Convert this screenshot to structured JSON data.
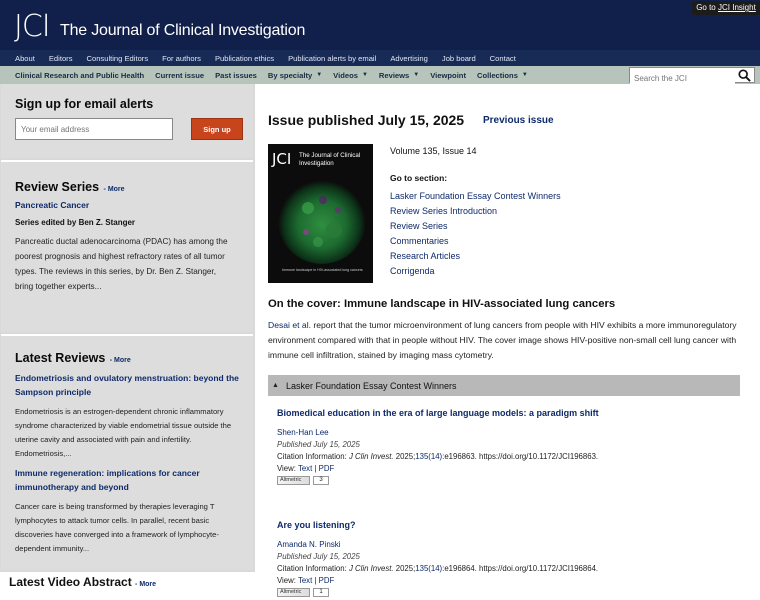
{
  "header": {
    "logo": "JCI",
    "journal_name": "The Journal of Clinical Investigation",
    "insight_prefix": "Go to",
    "insight_link": "JCI Insight"
  },
  "nav_primary": [
    "About",
    "Editors",
    "Consulting Editors",
    "For authors",
    "Publication ethics",
    "Publication alerts by email",
    "Advertising",
    "Job board",
    "Contact"
  ],
  "nav_secondary": [
    {
      "label": "Clinical Research and Public Health",
      "dropdown": false
    },
    {
      "label": "Current issue",
      "dropdown": false
    },
    {
      "label": "Past issues",
      "dropdown": false
    },
    {
      "label": "By specialty",
      "dropdown": true
    },
    {
      "label": "Videos",
      "dropdown": true
    },
    {
      "label": "Reviews",
      "dropdown": true
    },
    {
      "label": "Viewpoint",
      "dropdown": false
    },
    {
      "label": "Collections",
      "dropdown": true
    }
  ],
  "search": {
    "placeholder": "Search the JCI"
  },
  "sidebar": {
    "email": {
      "heading": "Sign up for email alerts",
      "placeholder": "Your email address",
      "button": "Sign up"
    },
    "review_series": {
      "heading": "Review Series",
      "more": "- More",
      "title": "Pancreatic Cancer",
      "editor": "Series edited by Ben Z. Stanger",
      "body": "Pancreatic ductal adenocarcinoma (PDAC) has among the poorest prognosis and highest refractory rates of all tumor types. The reviews in this series, by Dr. Ben Z. Stanger, bring together experts..."
    },
    "latest_reviews": {
      "heading": "Latest Reviews",
      "more": "- More",
      "items": [
        {
          "title": "Endometriosis and ovulatory menstruation: beyond the Sampson principle",
          "body": "Endometriosis is an estrogen-dependent chronic inflammatory syndrome characterized by viable endometrial tissue outside the uterine cavity and associated with pain and infertility. Endometriosis,..."
        },
        {
          "title": "Immune regeneration: implications for cancer immunotherapy and beyond",
          "body": "Cancer care is being transformed by therapies leveraging T lymphocytes to attack tumor cells. In parallel, recent basic discoveries have converged into a framework of lymphocyte-dependent immunity..."
        }
      ]
    },
    "latest_video": {
      "heading": "Latest Video Abstract",
      "more": "- More"
    }
  },
  "main": {
    "issue_title": "Issue published July 15, 2025",
    "previous_issue": "Previous issue",
    "cover_text": "The Journal of Clinical Investigation",
    "cover_caption": "Immune landscape in HIV-associated lung cancers",
    "volume": "Volume 135, Issue 14",
    "goto_label": "Go to section:",
    "sections": [
      "Lasker Foundation Essay Contest Winners",
      "Review Series Introduction",
      "Review Series",
      "Commentaries",
      "Research Articles",
      "Corrigenda"
    ],
    "cover_heading": "On the cover: Immune landscape in HIV-associated lung cancers",
    "cover_desc_link": "Desai et al.",
    "cover_desc": " report that the tumor microenvironment of lung cancers from people with HIV exhibits a more immunoregulatory environment compared with that in people without HIV. The cover image shows HIV-positive non-small cell lung cancer with immune cell infiltration, stained by imaging mass cytometry.",
    "section_bar": "Lasker Foundation Essay Contest Winners",
    "articles": [
      {
        "title": "Biomedical education in the era of large language models: a paradigm shift",
        "author": "Shen-Han Lee",
        "published": "Published July 15, 2025",
        "cite_prefix": "Citation Information: ",
        "cite_journal": "J Clin Invest.",
        "cite_year": " 2025;",
        "cite_issue": "135(14)",
        "cite_rest": ":e196863. https://doi.org/10.1172/JCI196863.",
        "view_label": "View: ",
        "view_text": "Text",
        "view_sep": " | ",
        "view_pdf": "PDF",
        "altmetric_label": "Altmetric",
        "altmetric_count": "3"
      },
      {
        "title": "Are you listening?",
        "author": "Amanda N. Pinski",
        "published": "Published July 15, 2025",
        "cite_prefix": "Citation Information: ",
        "cite_journal": "J Clin Invest.",
        "cite_year": " 2025;",
        "cite_issue": "135(14)",
        "cite_rest": ":e196864. https://doi.org/10.1172/JCI196864.",
        "view_label": "View: ",
        "view_text": "Text",
        "view_sep": " | ",
        "view_pdf": "PDF",
        "altmetric_label": "Altmetric",
        "altmetric_count": "1"
      }
    ]
  }
}
